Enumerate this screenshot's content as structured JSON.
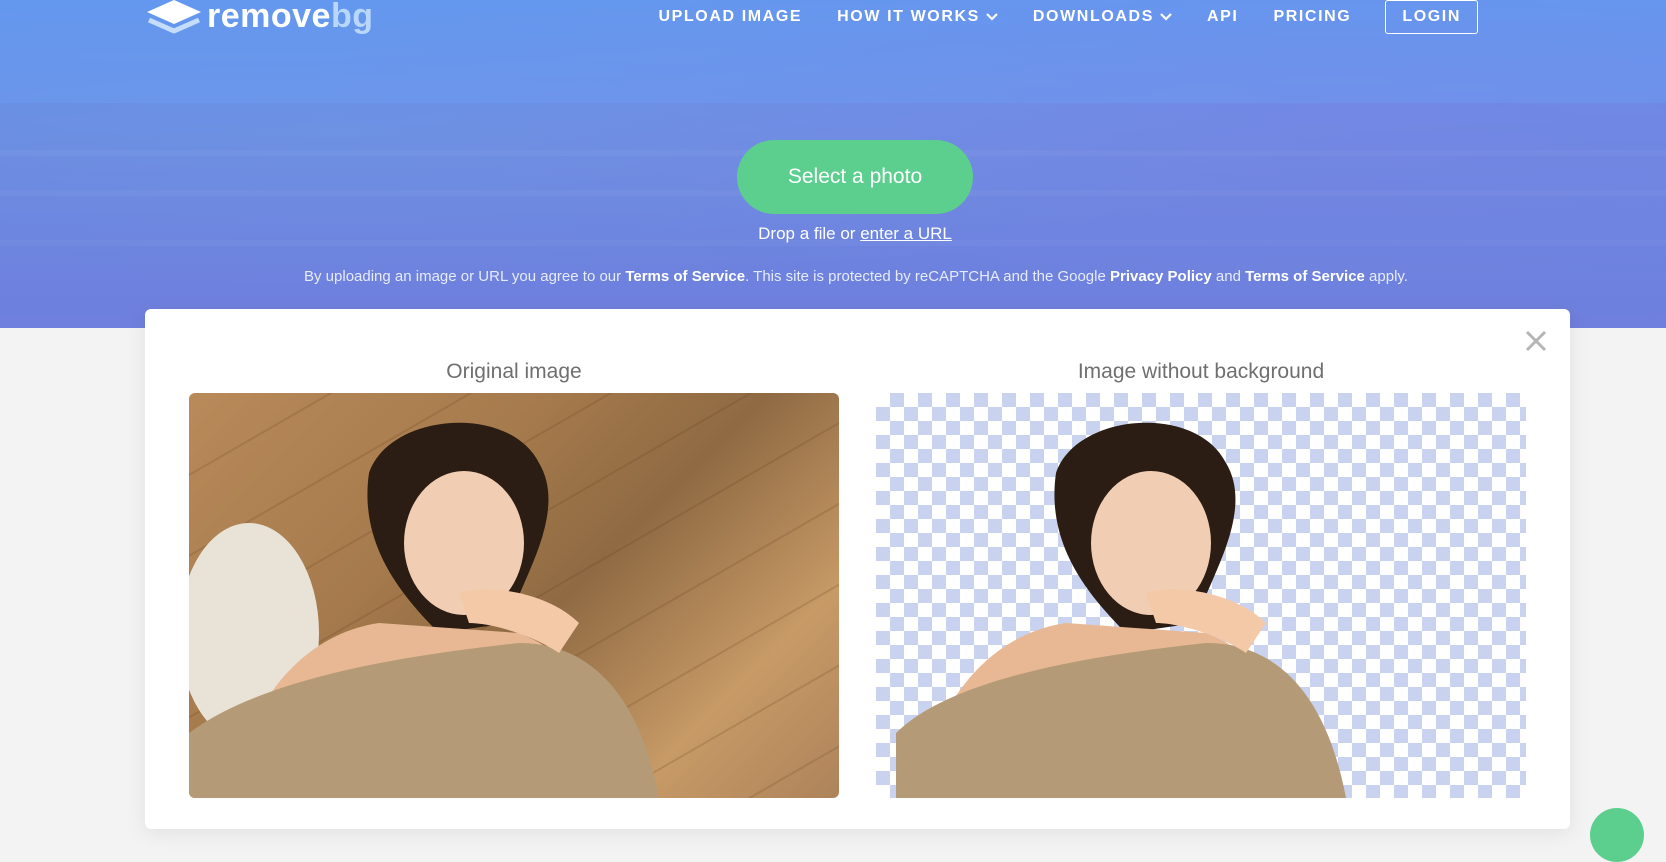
{
  "logo": {
    "part1": "remove",
    "part2": "bg"
  },
  "nav": {
    "upload": "UPLOAD IMAGE",
    "how": "HOW IT WORKS",
    "downloads": "DOWNLOADS",
    "api": "API",
    "pricing": "PRICING",
    "login": "LOGIN"
  },
  "upload": {
    "select_label": "Select a photo",
    "drop_prefix": "Drop a file or ",
    "enter_url": "enter a URL"
  },
  "terms": {
    "t1": "By uploading an image or URL you agree to our ",
    "tos1": "Terms of Service",
    "t2": ". This site is protected by reCAPTCHA and the Google ",
    "privacy": "Privacy Policy",
    "t3": " and ",
    "tos2": "Terms of Service",
    "t4": " apply."
  },
  "result": {
    "original_title": "Original image",
    "cutout_title": "Image without background"
  },
  "colors": {
    "accent_green": "#5ccf8f",
    "hero_blue": "#6a87e0",
    "checker": "#c9d3ef"
  },
  "icons": {
    "logo": "layers-logo-icon",
    "chevron": "chevron-down-icon",
    "close": "close-icon",
    "chat": "chat-bubble-icon"
  }
}
